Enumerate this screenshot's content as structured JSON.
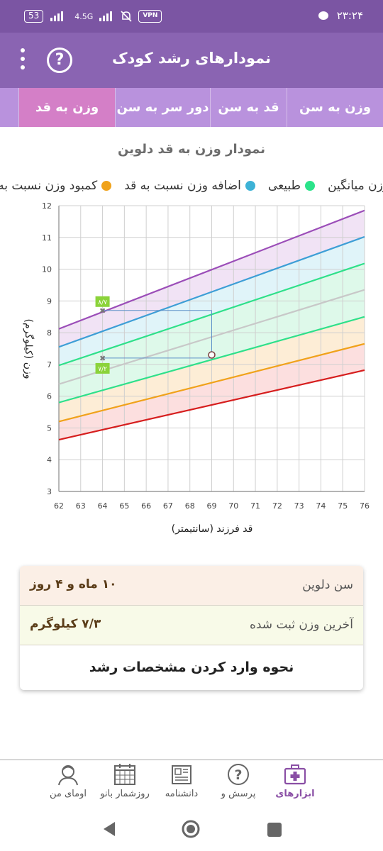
{
  "status_bar": {
    "battery": "53",
    "network": "4.5G",
    "vpn": "VPN",
    "time": "۲۳:۲۴"
  },
  "app_bar": {
    "title": "نمودارهای رشد کودک",
    "help_glyph": "?"
  },
  "tabs": [
    {
      "label": "وزن به سن",
      "active": false
    },
    {
      "label": "قد به سن",
      "active": false
    },
    {
      "label": "دور سر به سن",
      "active": false
    },
    {
      "label": "وزن به قد",
      "active": true
    },
    {
      "label": "",
      "active": false
    }
  ],
  "chart_title": "نمودار وزن به قد دلوین",
  "legend": [
    {
      "label": "وزن میانگین",
      "color": "#d3d3d3"
    },
    {
      "label": "طبیعی",
      "color": "#2be38a"
    },
    {
      "label": "اضافه وزن نسبت به قد",
      "color": "#3db2d6"
    },
    {
      "label": "کمبود وزن نسبت به قد",
      "color": "#f0a21a"
    }
  ],
  "chart_data": {
    "type": "area",
    "xlabel": "قد فرزند (سانتیمتر)",
    "ylabel": "وزن (کیلوگرم)",
    "xlim": [
      62,
      76
    ],
    "ylim": [
      3,
      12
    ],
    "grid": true,
    "x_ticks": [
      62,
      63,
      64,
      65,
      66,
      67,
      68,
      69,
      70,
      71,
      72,
      73,
      74,
      75,
      76
    ],
    "y_ticks": [
      3,
      4,
      5,
      6,
      7,
      8,
      9,
      10,
      11,
      12
    ],
    "x": [
      62,
      76
    ],
    "series": [
      {
        "values": [
          4.63,
          6.82
        ],
        "color": "#d61e1e",
        "fill": "#fbd7d7"
      },
      {
        "values": [
          5.2,
          7.65
        ],
        "color": "#f0a21a",
        "fill": "#fde9cc"
      },
      {
        "values": [
          5.8,
          8.5
        ],
        "color": "#2ee08a",
        "fill": "#d6f7e5"
      },
      {
        "values": [
          6.38,
          9.35
        ],
        "color": "#c8c8c8",
        "fill": "#d6f7e5"
      },
      {
        "values": [
          6.97,
          10.18
        ],
        "color": "#2ee08a",
        "fill": "#d8f1f8"
      },
      {
        "values": [
          7.55,
          11.02
        ],
        "color": "#3d9ed6",
        "fill": "#eddcf3"
      },
      {
        "values": [
          8.12,
          11.85
        ],
        "color": "#9b4db8",
        "fill": "none"
      }
    ],
    "child_point": {
      "x": 69,
      "y": 7.3
    },
    "annotations": [
      {
        "x": 64,
        "y": 8.7,
        "label": "۸/۷"
      },
      {
        "x": 64,
        "y": 7.2,
        "label": "۷/۲"
      }
    ]
  },
  "info_card": {
    "age_label": "سن دلوین",
    "age_value": "۱۰ ماه و ۴ روز",
    "weight_label": "آخرین وزن ثبت شده",
    "weight_value": "۷/۳ کیلوگرم",
    "link_label": "نحوه وارد کردن مشخصات رشد"
  },
  "bottom_nav": [
    {
      "label": "ابزارهای",
      "icon": "medical-kit-icon",
      "active": true
    },
    {
      "label": "پرسش و",
      "icon": "question-icon",
      "active": false
    },
    {
      "label": "دانشنامه",
      "icon": "encyclopedia-icon",
      "active": false
    },
    {
      "label": "روزشمار بانو",
      "icon": "calendar-icon",
      "active": false
    },
    {
      "label": "اومای من",
      "icon": "profile-icon",
      "active": false
    }
  ]
}
